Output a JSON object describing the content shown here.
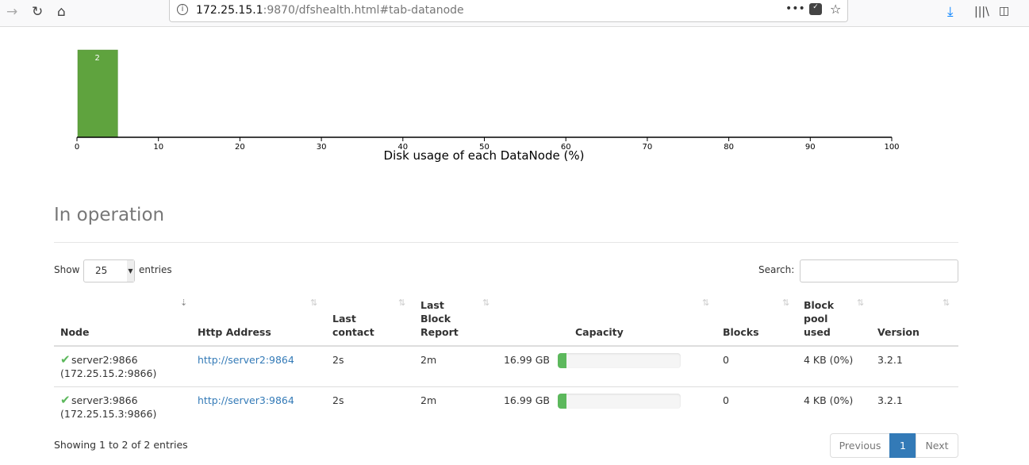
{
  "browser": {
    "url_host": "172.25.15.1",
    "url_rest": ":9870/dfshealth.html#tab-datanode",
    "icons": [
      "back-icon",
      "reload-icon",
      "home-icon",
      "info-icon",
      "more-icon",
      "pocket-icon",
      "bookmark-star-icon",
      "download-icon",
      "library-icon",
      "sidebar-icon"
    ]
  },
  "chart_data": {
    "type": "bar",
    "title": "",
    "xlabel": "Disk usage of each DataNode (%)",
    "xlim": [
      0,
      100
    ],
    "xticks": [
      "0",
      "10",
      "20",
      "30",
      "40",
      "50",
      "60",
      "70",
      "80",
      "90",
      "100"
    ],
    "bins": [
      {
        "x0": 0,
        "x1": 5,
        "count": 2
      }
    ],
    "bar_color": "#5fa33e"
  },
  "section": {
    "title": "In operation"
  },
  "controls": {
    "show_label": "Show",
    "entries_value": "25",
    "entries_label": "entries",
    "search_label": "Search:",
    "search_value": ""
  },
  "table": {
    "headers": [
      "Node",
      "Http Address",
      "Last contact",
      "Last Block Report",
      "Capacity",
      "Blocks",
      "Block pool used",
      "Version"
    ],
    "rows": [
      {
        "node": "server2:9866",
        "ip": "(172.25.15.2:9866)",
        "http": "http://server2:9864",
        "last_contact": "2s",
        "last_block_report": "2m",
        "capacity": "16.99 GB",
        "capacity_used_pct": 7,
        "blocks": "0",
        "block_pool_used": "4 KB (0%)",
        "version": "3.2.1"
      },
      {
        "node": "server3:9866",
        "ip": "(172.25.15.3:9866)",
        "http": "http://server3:9864",
        "last_contact": "2s",
        "last_block_report": "2m",
        "capacity": "16.99 GB",
        "capacity_used_pct": 7,
        "blocks": "0",
        "block_pool_used": "4 KB (0%)",
        "version": "3.2.1"
      }
    ]
  },
  "footer": {
    "info": "Showing 1 to 2 of 2 entries",
    "previous": "Previous",
    "page": "1",
    "next": "Next"
  },
  "colors": {
    "accent": "#337ab7",
    "ok": "#5cb85c"
  }
}
